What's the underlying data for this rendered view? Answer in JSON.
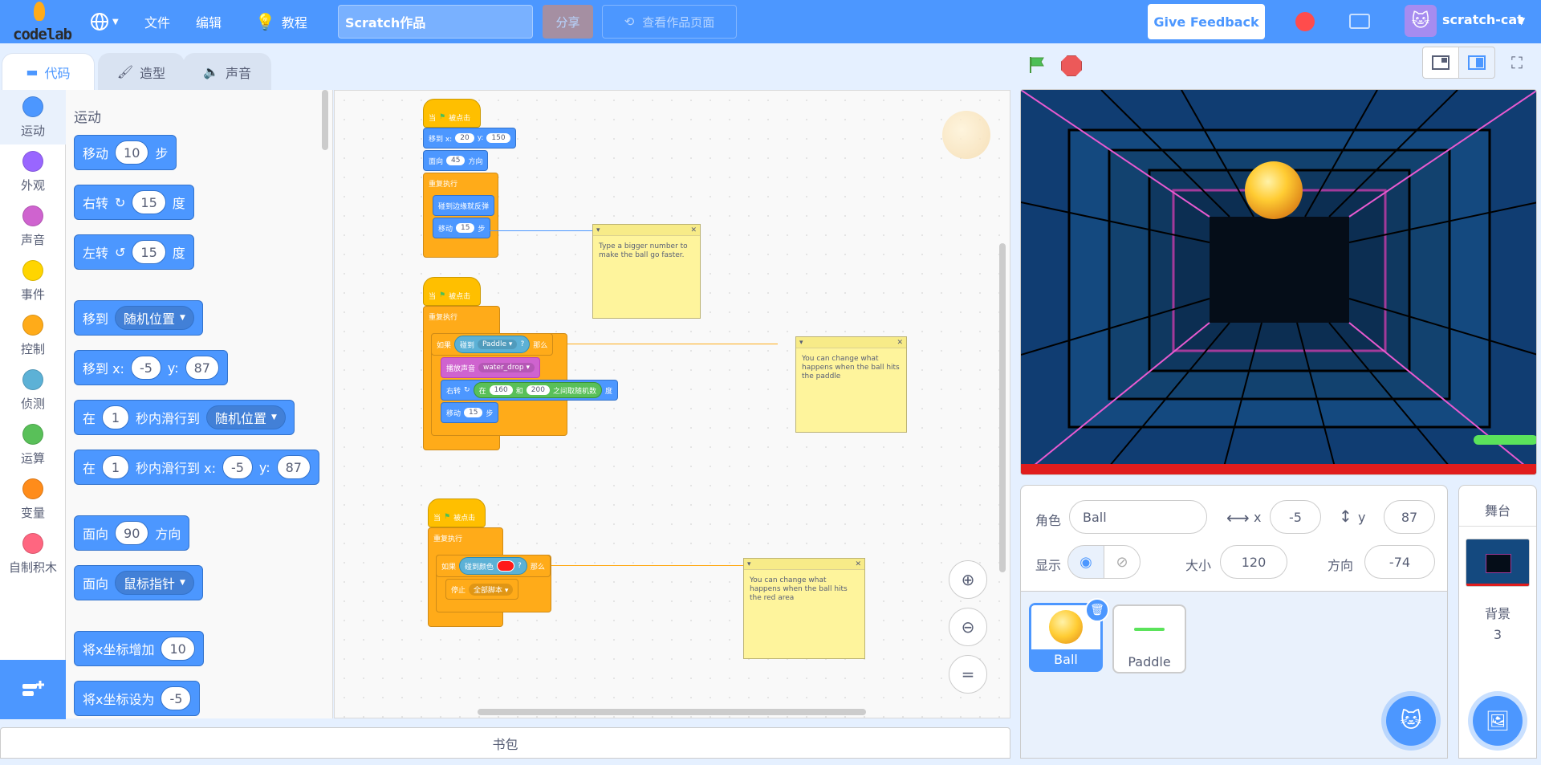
{
  "menubar": {
    "logo_text": "codelab",
    "file": "文件",
    "edit": "编辑",
    "tutorials": "教程",
    "project_title": "Scratch作品",
    "share": "分享",
    "see_project": "查看作品页面",
    "feedback": "Give Feedback",
    "username": "scratch-cat"
  },
  "tabs": [
    "代码",
    "造型",
    "声音"
  ],
  "categories": [
    {
      "label": "运动",
      "color": "#4c97ff"
    },
    {
      "label": "外观",
      "color": "#9966ff"
    },
    {
      "label": "声音",
      "color": "#cf63cf"
    },
    {
      "label": "事件",
      "color": "#ffd500"
    },
    {
      "label": "控制",
      "color": "#ffab19"
    },
    {
      "label": "侦测",
      "color": "#5cb1d6"
    },
    {
      "label": "运算",
      "color": "#59c059"
    },
    {
      "label": "变量",
      "color": "#ff8c1a"
    },
    {
      "label": "自制积木",
      "color": "#ff6680"
    }
  ],
  "palette": {
    "title": "运动",
    "move": {
      "a": "移动",
      "v": "10",
      "b": "步"
    },
    "turn_right": {
      "a": "右转",
      "v": "15",
      "b": "度"
    },
    "turn_left": {
      "a": "左转",
      "v": "15",
      "b": "度"
    },
    "goto": {
      "a": "移到",
      "dd": "随机位置"
    },
    "goto_xy": {
      "a": "移到 x:",
      "x": "-5",
      "yl": "y:",
      "y": "87"
    },
    "glide": {
      "a": "在",
      "v": "1",
      "b": "秒内滑行到",
      "dd": "随机位置"
    },
    "glide_xy": {
      "a": "在",
      "v": "1",
      "b": "秒内滑行到 x:",
      "x": "-5",
      "yl": "y:",
      "y": "87"
    },
    "point": {
      "a": "面向",
      "v": "90",
      "b": "方向"
    },
    "point_to": {
      "a": "面向",
      "dd": "鼠标指针"
    },
    "change_x": {
      "a": "将x坐标增加",
      "v": "10"
    },
    "set_x": {
      "a": "将x坐标设为",
      "v": "-5"
    }
  },
  "scripts": {
    "s1": {
      "hat": "当",
      "hat_b": "被点击",
      "goto": "移到 x:",
      "x": "20",
      "yl": "y:",
      "y": "150",
      "point": "面向",
      "dir": "45",
      "dir_b": "方向",
      "forever": "重复执行",
      "bounce": "碰到边缘就反弹",
      "move": "移动",
      "steps": "15",
      "steps_b": "步"
    },
    "s2": {
      "hat": "当",
      "hat_b": "被点击",
      "forever": "重复执行",
      "if": "如果",
      "touch": "碰到",
      "obj": "Paddle",
      "q": "?",
      "then": "那么",
      "sound": "播放声音",
      "snd": "water_drop",
      "turn": "右转",
      "r1": "在",
      "a": "160",
      "and": "和",
      "b": "200",
      "rnd": "之间取随机数",
      "deg": "度",
      "move": "移动",
      "steps": "15",
      "steps_b": "步"
    },
    "s3": {
      "hat": "当",
      "hat_b": "被点击",
      "forever": "重复执行",
      "if": "如果",
      "touch_color": "碰到颜色",
      "q": "?",
      "then": "那么",
      "stop": "停止",
      "all": "全部脚本"
    }
  },
  "notes": {
    "n1": "Type a bigger number to make the ball go faster.",
    "n2": "You can change what happens when the ball hits the paddle",
    "n3": "You can change what happens when the ball hits the red area"
  },
  "backpack": "书包",
  "sprite_info": {
    "sprite_label": "角色",
    "sprite_name": "Ball",
    "x_label": "x",
    "x": "-5",
    "y_label": "y",
    "y": "87",
    "show_label": "显示",
    "size_label": "大小",
    "size": "120",
    "dir_label": "方向",
    "direction": "-74"
  },
  "sprites": [
    "Ball",
    "Paddle"
  ],
  "stage_panel": {
    "title": "舞台",
    "bg_label": "背景",
    "bg_count": "3"
  }
}
